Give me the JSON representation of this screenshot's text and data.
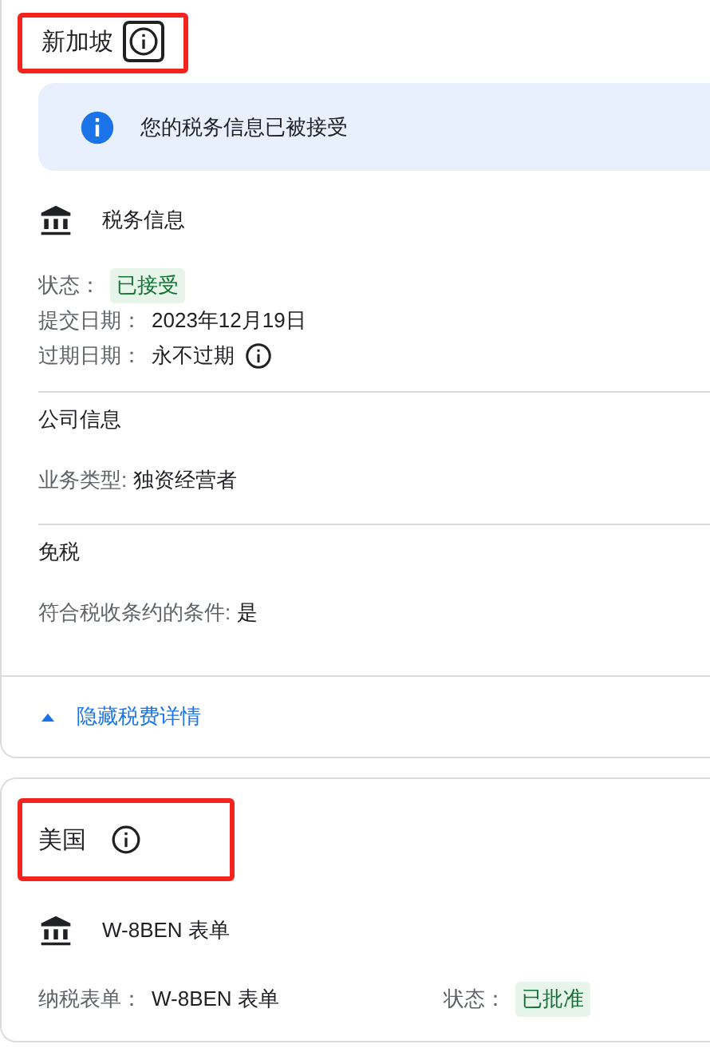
{
  "regions": [
    {
      "country": "新加坡",
      "highlighted": true,
      "info_focused": true,
      "banner": {
        "text": "您的税务信息已被接受"
      },
      "heading": "税务信息",
      "fields": [
        {
          "label": "状态：",
          "value": "已接受",
          "kind": "badge"
        },
        {
          "label": "提交日期：",
          "value": "2023年12月19日",
          "kind": "text"
        },
        {
          "label": "过期日期：",
          "value": "永不过期",
          "kind": "info"
        }
      ],
      "subsections": [
        {
          "title": "公司信息",
          "label": "业务类型:",
          "value": "独资经营者"
        },
        {
          "title": "免税",
          "label": "符合税收条约的条件:",
          "value": "是"
        }
      ],
      "toggle": {
        "label": "隐藏税费详情",
        "expanded": true
      }
    },
    {
      "country": "美国",
      "highlighted": true,
      "info_focused": false,
      "heading": "W-8BEN 表单",
      "row": [
        {
          "label": "纳税表单：",
          "value": "W-8BEN 表单",
          "kind": "text"
        },
        {
          "label": "状态：",
          "value": "已批准",
          "kind": "badge"
        }
      ]
    }
  ]
}
